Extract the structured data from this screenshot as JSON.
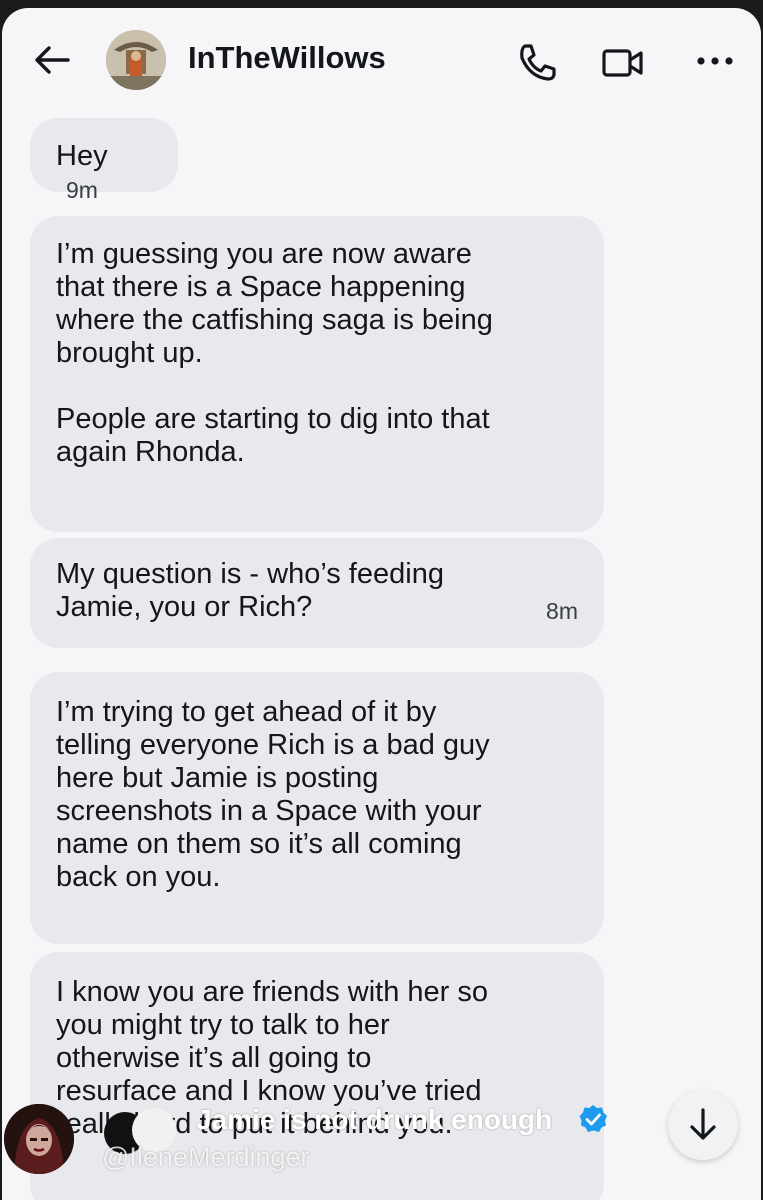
{
  "header": {
    "username": "InTheWillows",
    "back_icon": "arrow-left-icon",
    "call_icon": "phone-icon",
    "video_icon": "video-camera-icon",
    "more_icon": "more-dots-icon"
  },
  "messages": [
    {
      "lines": [
        "Hey"
      ],
      "time": "9m"
    },
    {
      "lines": [
        "I’m guessing you are now aware",
        "that there is a Space happening",
        "where the catfishing saga is being",
        "brought up.",
        "",
        "People are starting to dig into that",
        "again Rhonda."
      ]
    },
    {
      "lines": [
        "My question is - who’s feeding",
        "Jamie, you or Rich?"
      ],
      "time": "8m"
    },
    {
      "lines": [
        "I’m trying to get ahead of it by",
        "telling everyone Rich is a bad guy",
        "here but Jamie is posting",
        "screenshots in a Space with your",
        "name on them so it’s all coming",
        "back on you."
      ]
    },
    {
      "lines": [
        "I know you are friends with her so",
        "you might try to talk to her",
        "otherwise it’s all going to",
        "resurface and I know you’ve tried",
        "really hard to put it behind you."
      ]
    }
  ],
  "overlay": {
    "title": "Jamie is not drunk enough",
    "handle": "@IleneMerdinger",
    "verified_icon": "verified-badge-icon",
    "scroll_icon": "arrow-down-icon"
  },
  "colors": {
    "bubble_bg": "#e7e9ec",
    "screen_bg": "#f6f6f8",
    "verified": "#1d9bf0"
  }
}
